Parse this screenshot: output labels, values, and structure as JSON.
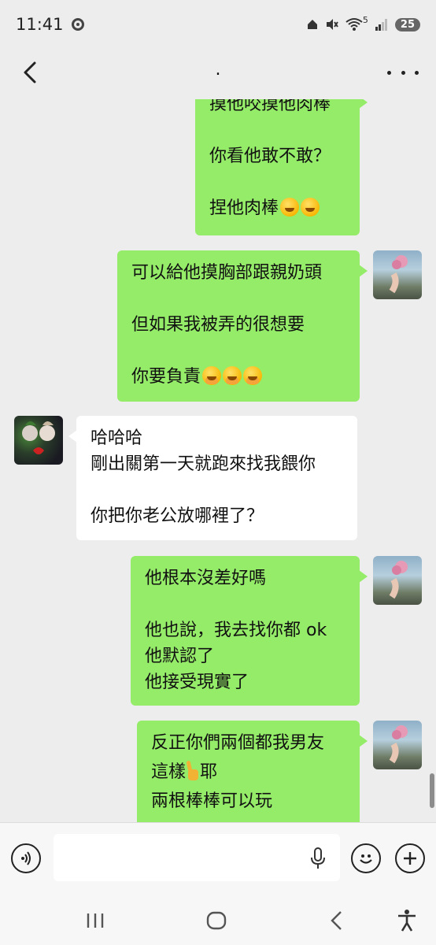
{
  "status_bar": {
    "time": "11:41",
    "signal_label": "5",
    "battery": "25"
  },
  "header": {
    "title": "."
  },
  "messages": [
    {
      "id": "m1",
      "from": "me",
      "lines": [
        "摸他咬摸他肉棒",
        "",
        "你看他敢不敢？",
        "",
        "捏他肉棒"
      ],
      "emoji_suffix": [
        "laugh-emoji",
        "laugh-emoji"
      ]
    },
    {
      "id": "m2",
      "from": "me",
      "lines": [
        "可以給他摸胸部跟親奶頭",
        "",
        "但如果我被弄的很想要",
        "",
        "你要負責"
      ],
      "emoji_suffix": [
        "hand-over-mouth-emoji",
        "hand-over-mouth-emoji",
        "hand-over-mouth-emoji"
      ]
    },
    {
      "id": "m3",
      "from": "them",
      "lines": [
        "哈哈哈",
        "剛出關第一天就跑來找我餵你",
        "",
        "你把你老公放哪裡了？"
      ]
    },
    {
      "id": "m4",
      "from": "me",
      "lines": [
        "他根本沒差好嗎",
        "",
        "他也說，我去找你都 ok",
        "他默認了",
        "他接受現實了"
      ]
    },
    {
      "id": "m5",
      "from": "me",
      "lines": [
        "反正你們兩個都我男友",
        "這樣",
        "兩根棒棒可以玩"
      ],
      "inline_emoji": "victory-hand-emoji",
      "inline_after": "耶"
    }
  ],
  "input": {
    "value": "",
    "placeholder": ""
  },
  "colors": {
    "my_bubble": "#95ec69",
    "their_bubble": "#ffffff",
    "background": "#ededed"
  },
  "icons": {
    "back": "chevron-left-icon",
    "more": "more-dots-icon",
    "voice": "voice-icon",
    "mic": "mic-icon",
    "emoji": "smiley-icon",
    "plus": "plus-icon",
    "nav_recent": "recent-apps-icon",
    "nav_home": "home-icon",
    "nav_back": "back-icon",
    "nav_accessibility": "accessibility-icon"
  }
}
